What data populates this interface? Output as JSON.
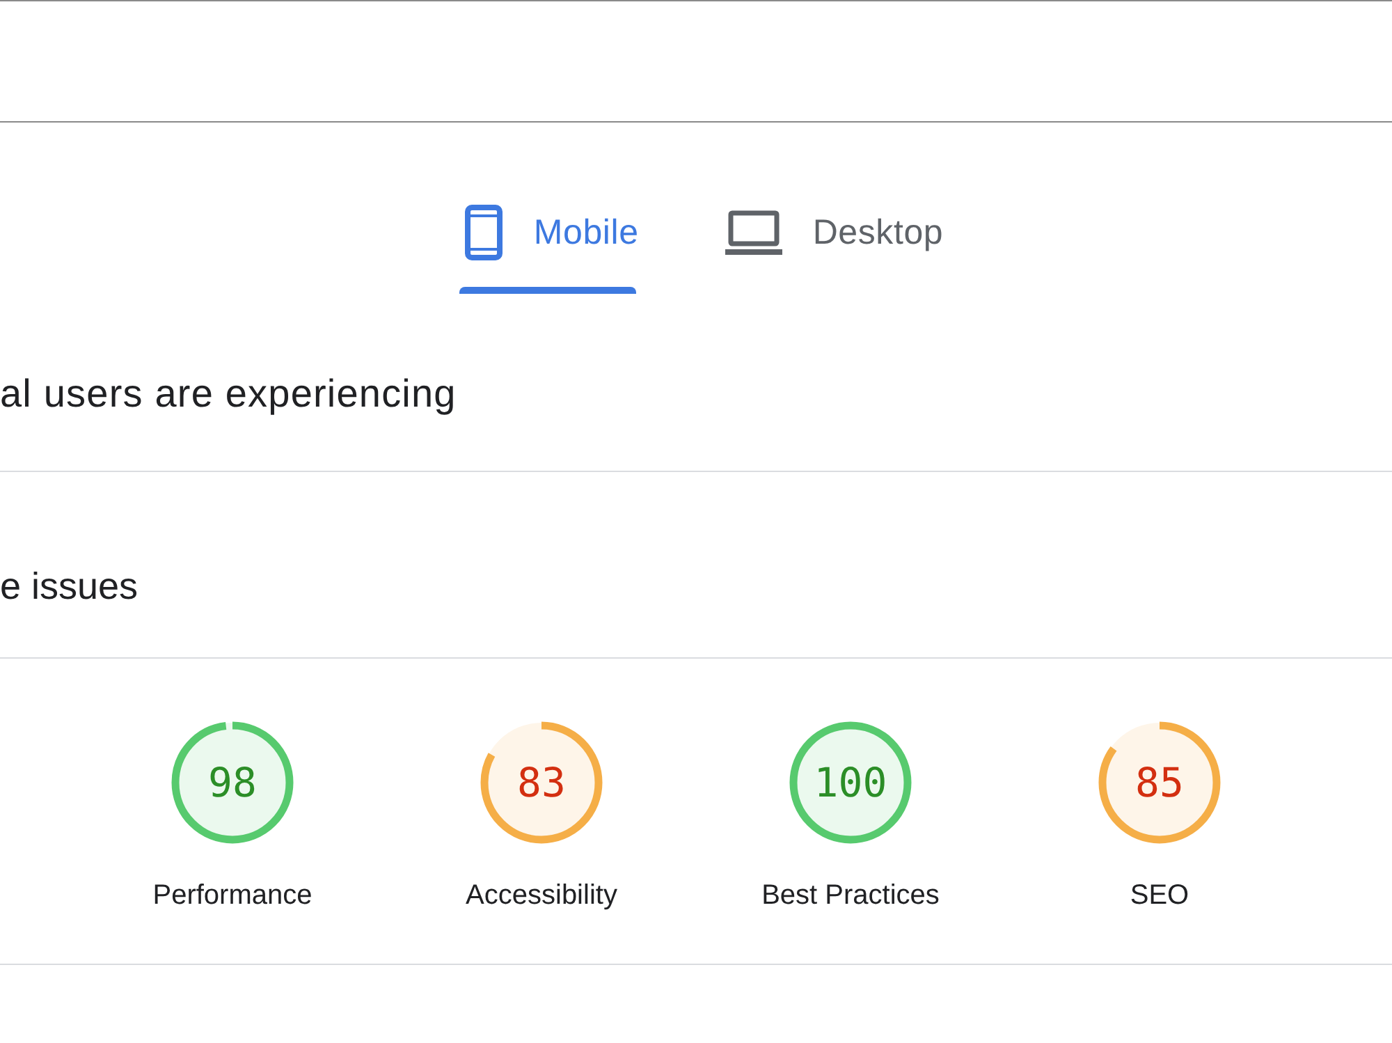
{
  "tabs": [
    {
      "kind": "mobile",
      "label": "Mobile",
      "selected": true
    },
    {
      "kind": "desktop",
      "label": "Desktop",
      "selected": false
    }
  ],
  "sections": [
    {
      "heading": "al users are experiencing"
    },
    {
      "heading": "e issues"
    }
  ],
  "scores": [
    {
      "score": "98",
      "label": "Performance",
      "level": 0.98,
      "color": "#57ca6e"
    },
    {
      "score": "83",
      "label": "Accessibility",
      "level": 0.83,
      "color": "#f5ae47"
    },
    {
      "score": "100",
      "label": "Best Practices",
      "level": 1,
      "color": "#57ca6e"
    },
    {
      "score": "85",
      "label": "SEO",
      "level": 0.85,
      "color": "#f5ae47"
    }
  ]
}
